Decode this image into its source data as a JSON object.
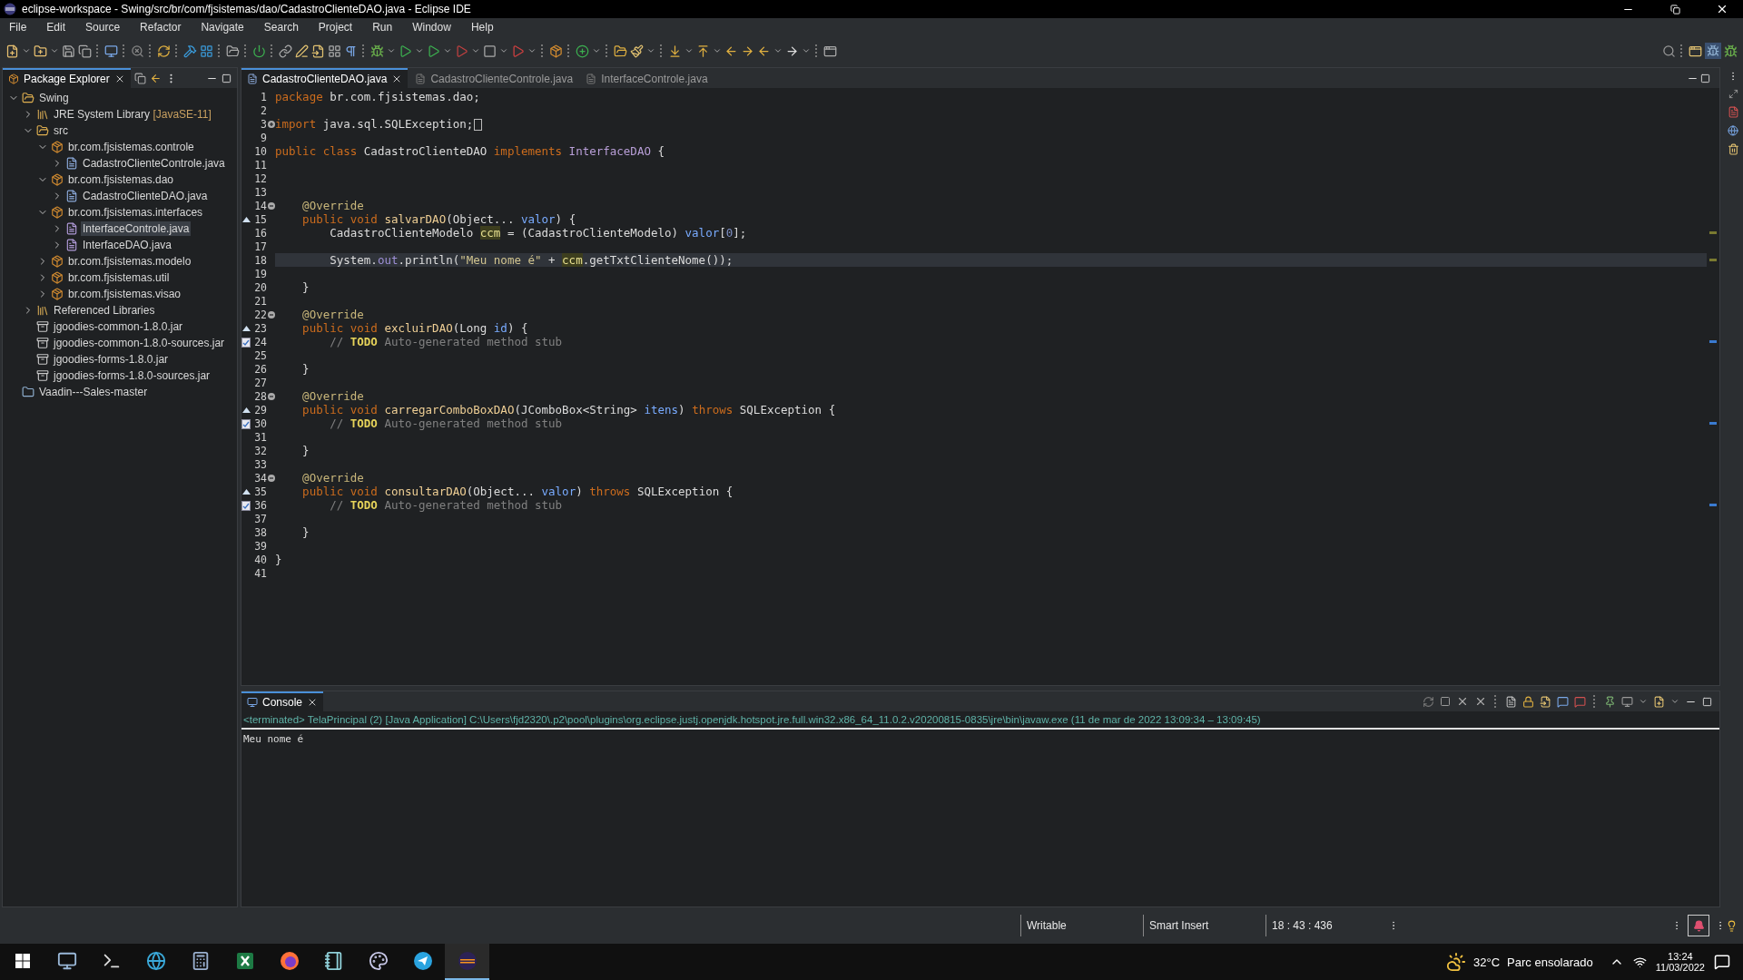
{
  "window": {
    "title": "eclipse-workspace - Swing/src/br/com/fjsistemas/dao/CadastroClienteDAO.java - Eclipse IDE"
  },
  "menu": [
    "File",
    "Edit",
    "Source",
    "Refactor",
    "Navigate",
    "Search",
    "Project",
    "Run",
    "Window",
    "Help"
  ],
  "package_explorer": {
    "title": "Package Explorer",
    "items": [
      {
        "label": "Swing",
        "kind": "project",
        "expanded": true,
        "selected": false,
        "children": [
          {
            "label": "JRE System Library",
            "decoration": "[JavaSE-11]",
            "kind": "library",
            "expanded": false,
            "selected": false
          },
          {
            "label": "src",
            "kind": "folder",
            "expanded": true,
            "selected": false,
            "children": [
              {
                "label": "br.com.fjsistemas.controle",
                "kind": "package",
                "expanded": true,
                "selected": false,
                "children": [
                  {
                    "label": "CadastroClienteControle.java",
                    "kind": "java",
                    "expanded": false,
                    "selected": false
                  }
                ]
              },
              {
                "label": "br.com.fjsistemas.dao",
                "kind": "package",
                "expanded": true,
                "selected": false,
                "children": [
                  {
                    "label": "CadastroClienteDAO.java",
                    "kind": "java",
                    "expanded": false,
                    "selected": false
                  }
                ]
              },
              {
                "label": "br.com.fjsistemas.interfaces",
                "kind": "package",
                "expanded": true,
                "selected": false,
                "children": [
                  {
                    "label": "InterfaceControle.java",
                    "kind": "interface",
                    "expanded": false,
                    "selected": true
                  },
                  {
                    "label": "InterfaceDAO.java",
                    "kind": "interface",
                    "expanded": false,
                    "selected": false
                  }
                ]
              },
              {
                "label": "br.com.fjsistemas.modelo",
                "kind": "package",
                "expanded": false,
                "selected": false
              },
              {
                "label": "br.com.fjsistemas.util",
                "kind": "package",
                "expanded": false,
                "selected": false
              },
              {
                "label": "br.com.fjsistemas.visao",
                "kind": "package",
                "expanded": false,
                "selected": false
              }
            ]
          },
          {
            "label": "Referenced Libraries",
            "kind": "library",
            "expanded": false,
            "selected": false
          },
          {
            "label": "jgoodies-common-1.8.0.jar",
            "kind": "jar",
            "selected": false
          },
          {
            "label": "jgoodies-common-1.8.0-sources.jar",
            "kind": "jar",
            "selected": false
          },
          {
            "label": "jgoodies-forms-1.8.0.jar",
            "kind": "jar",
            "selected": false
          },
          {
            "label": "jgoodies-forms-1.8.0-sources.jar",
            "kind": "jar",
            "selected": false
          }
        ]
      },
      {
        "label": "Vaadin---Sales-master",
        "kind": "closed-project",
        "selected": false
      }
    ]
  },
  "editor": {
    "tabs": [
      {
        "label": "CadastroClienteDAO.java",
        "selected": true
      },
      {
        "label": "CadastroClienteControle.java",
        "selected": false
      },
      {
        "label": "InterfaceControle.java",
        "selected": false
      }
    ],
    "lines": [
      {
        "number": "1",
        "segments": [
          {
            "kind": "keyword",
            "text": "package"
          },
          {
            "kind": "plain",
            "text": " br.com.fjsistemas.dao;"
          }
        ]
      },
      {
        "number": "2"
      },
      {
        "number": "3",
        "collapsed": true,
        "segments": [
          {
            "kind": "keyword",
            "text": "import"
          },
          {
            "kind": "plain",
            "text": " java.sql.SQLException;"
          }
        ]
      },
      {
        "number": "9"
      },
      {
        "number": "10",
        "segments": [
          {
            "kind": "keyword",
            "text": "public class"
          },
          {
            "kind": "plain",
            "text": " CadastroClienteDAO "
          },
          {
            "kind": "keyword",
            "text": "implements"
          },
          {
            "kind": "interface",
            "text": " InterfaceDAO"
          },
          {
            "kind": "plain",
            "text": " {"
          }
        ]
      },
      {
        "number": "11"
      },
      {
        "number": "12"
      },
      {
        "number": "13"
      },
      {
        "number": "14",
        "collapsed": false,
        "segments": [
          {
            "kind": "annotation",
            "text": "    @Override"
          }
        ]
      },
      {
        "number": "15",
        "overrides": true,
        "segments": [
          {
            "kind": "keyword",
            "text": "    public void "
          },
          {
            "kind": "method",
            "text": "salvarDAO"
          },
          {
            "kind": "plain",
            "text": "(Object... "
          },
          {
            "kind": "param",
            "text": "valor"
          },
          {
            "kind": "plain",
            "text": ") {"
          }
        ]
      },
      {
        "number": "16",
        "segments": [
          {
            "kind": "plain",
            "text": "        CadastroClienteModelo "
          },
          {
            "kind": "occurrence",
            "text": "ccm"
          },
          {
            "kind": "plain",
            "text": " = (CadastroClienteModelo) "
          },
          {
            "kind": "param",
            "text": "valor"
          },
          {
            "kind": "plain",
            "text": "["
          },
          {
            "kind": "number",
            "text": "0"
          },
          {
            "kind": "plain",
            "text": "];"
          }
        ]
      },
      {
        "number": "17"
      },
      {
        "number": "18",
        "current": true,
        "segments": [
          {
            "kind": "plain",
            "text": "        System."
          },
          {
            "kind": "field",
            "text": "out"
          },
          {
            "kind": "plain",
            "text": ".println("
          },
          {
            "kind": "string",
            "text": "\"Meu nome é\""
          },
          {
            "kind": "plain",
            "text": " + "
          },
          {
            "kind": "occurrence",
            "text": "ccm"
          },
          {
            "kind": "plain",
            "text": ".getTxtClienteNome());"
          }
        ]
      },
      {
        "number": "19"
      },
      {
        "number": "20",
        "segments": [
          {
            "kind": "plain",
            "text": "    }"
          }
        ]
      },
      {
        "number": "21"
      },
      {
        "number": "22",
        "collapsed": false,
        "segments": [
          {
            "kind": "annotation",
            "text": "    @Override"
          }
        ]
      },
      {
        "number": "23",
        "overrides": true,
        "segments": [
          {
            "kind": "keyword",
            "text": "    public void "
          },
          {
            "kind": "method",
            "text": "excluirDAO"
          },
          {
            "kind": "plain",
            "text": "(Long "
          },
          {
            "kind": "param",
            "text": "id"
          },
          {
            "kind": "plain",
            "text": ") {"
          }
        ]
      },
      {
        "number": "24",
        "task": true,
        "segments": [
          {
            "kind": "comment",
            "text": "        // "
          },
          {
            "kind": "todo",
            "text": "TODO"
          },
          {
            "kind": "comment",
            "text": " Auto-generated method stub"
          }
        ]
      },
      {
        "number": "25"
      },
      {
        "number": "26",
        "segments": [
          {
            "kind": "plain",
            "text": "    }"
          }
        ]
      },
      {
        "number": "27"
      },
      {
        "number": "28",
        "collapsed": false,
        "segments": [
          {
            "kind": "annotation",
            "text": "    @Override"
          }
        ]
      },
      {
        "number": "29",
        "overrides": true,
        "segments": [
          {
            "kind": "keyword",
            "text": "    public void "
          },
          {
            "kind": "method",
            "text": "carregarComboBoxDAO"
          },
          {
            "kind": "plain",
            "text": "(JComboBox<String> "
          },
          {
            "kind": "param",
            "text": "itens"
          },
          {
            "kind": "plain",
            "text": ") "
          },
          {
            "kind": "keyword",
            "text": "throws"
          },
          {
            "kind": "plain",
            "text": " SQLException {"
          }
        ]
      },
      {
        "number": "30",
        "task": true,
        "segments": [
          {
            "kind": "comment",
            "text": "        // "
          },
          {
            "kind": "todo",
            "text": "TODO"
          },
          {
            "kind": "comment",
            "text": " Auto-generated method stub"
          }
        ]
      },
      {
        "number": "31"
      },
      {
        "number": "32",
        "segments": [
          {
            "kind": "plain",
            "text": "    }"
          }
        ]
      },
      {
        "number": "33"
      },
      {
        "number": "34",
        "collapsed": false,
        "segments": [
          {
            "kind": "annotation",
            "text": "    @Override"
          }
        ]
      },
      {
        "number": "35",
        "overrides": true,
        "segments": [
          {
            "kind": "keyword",
            "text": "    public void "
          },
          {
            "kind": "method",
            "text": "consultarDAO"
          },
          {
            "kind": "plain",
            "text": "(Object... "
          },
          {
            "kind": "param",
            "text": "valor"
          },
          {
            "kind": "plain",
            "text": ") "
          },
          {
            "kind": "keyword",
            "text": "throws"
          },
          {
            "kind": "plain",
            "text": " SQLException {"
          }
        ]
      },
      {
        "number": "36",
        "task": true,
        "segments": [
          {
            "kind": "comment",
            "text": "        // "
          },
          {
            "kind": "todo",
            "text": "TODO"
          },
          {
            "kind": "comment",
            "text": " Auto-generated method stub"
          }
        ]
      },
      {
        "number": "37"
      },
      {
        "number": "38",
        "segments": [
          {
            "kind": "plain",
            "text": "    }"
          }
        ]
      },
      {
        "number": "39"
      },
      {
        "number": "40",
        "segments": [
          {
            "kind": "plain",
            "text": "}"
          }
        ]
      },
      {
        "number": "41"
      }
    ]
  },
  "console": {
    "title": "Console",
    "status": "<terminated> TelaPrincipal (2) [Java Application] C:\\Users\\fjd2320\\.p2\\pool\\plugins\\org.eclipse.justj.openjdk.hotspot.jre.full.win32.x86_64_11.0.2.v20200815-0835\\jre\\bin\\javaw.exe  (11 de mar de 2022 13:09:34 – 13:09:45)",
    "output": "Meu nome é"
  },
  "status_bar": [
    "Writable",
    "Smart Insert",
    "18 : 43 : 436"
  ],
  "taskbar": {
    "apps": [
      {
        "kind": "files",
        "selected": false
      },
      {
        "kind": "terminal",
        "selected": false
      },
      {
        "kind": "browser",
        "selected": false
      },
      {
        "kind": "calculator",
        "selected": false
      },
      {
        "kind": "spreadsheet",
        "selected": false
      },
      {
        "kind": "firefox",
        "selected": false
      },
      {
        "kind": "notes",
        "selected": false
      },
      {
        "kind": "paint",
        "selected": false
      },
      {
        "kind": "messenger",
        "selected": false
      },
      {
        "kind": "ide",
        "selected": true
      }
    ],
    "temperature": "32°C",
    "weather": "Parc ensolarado",
    "time": "13:24",
    "date": "11/03/2022"
  }
}
